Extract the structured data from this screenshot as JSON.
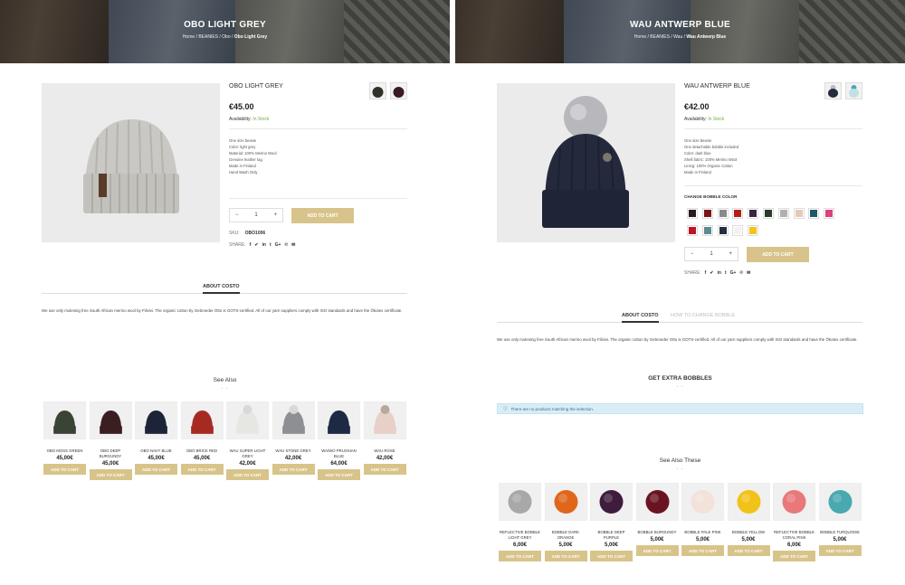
{
  "left": {
    "hero": {
      "title": "OBO LIGHT GREY",
      "crumb_path": "Home / BEANIES / Obo /",
      "crumb_current": "Obo Light Grey"
    },
    "product": {
      "title": "OBO LIGHT GREY",
      "price": "€45.00",
      "availability_label": "Availability:",
      "availability_value": "In Stock",
      "description": [
        "One size beanie",
        "Color: light grey",
        "Material: 100% Merino Wool",
        "Genuine leather tag",
        "Made in Finland",
        "Hand Wash Only"
      ],
      "qty": "1",
      "add_to_cart": "ADD TO CART",
      "sku_label": "SKU:",
      "sku_value": "OBO1006",
      "share_label": "SHARE:"
    },
    "tabs": [
      {
        "label": "ABOUT COSTO"
      }
    ],
    "about_text": "We use only mulesing free South African merino wool by Filivivi. The organic cotton by Gebroeder Otto is GOTS-certified. All of our yarn suppliers comply with ISO standards and have the Ökotex certificate.",
    "see_also": {
      "title": "See Also",
      "dots": "- -",
      "items": [
        {
          "name": "OBO MOSS GREEN",
          "price": "45,00€",
          "button": "ADD TO CART",
          "color": "#3a4436"
        },
        {
          "name": "OBO DEEP BURGUNDY",
          "price": "45,00€",
          "button": "ADD TO CART",
          "color": "#3b1e22"
        },
        {
          "name": "OBO NAVY BLUE",
          "price": "45,00€",
          "button": "ADD TO CART",
          "color": "#1e2438"
        },
        {
          "name": "OBO BRICK RED",
          "price": "45,00€",
          "button": "ADD TO CART",
          "color": "#a72a22"
        },
        {
          "name": "WAU SUPER LIGHT GREY",
          "price": "42,00€",
          "button": "ADD TO CART",
          "color": "#e6e6e2"
        },
        {
          "name": "WAU STONE GREY",
          "price": "42,00€",
          "button": "ADD TO CART",
          "color": "#8d8f92"
        },
        {
          "name": "WAIWO PRUSSIAN BLUE",
          "price": "64,00€",
          "button": "ADD TO CART",
          "color": "#1d2a44"
        },
        {
          "name": "WAU ROSE",
          "price": "42,00€",
          "button": "ADD TO CART",
          "color": "#e8cfc8"
        }
      ]
    }
  },
  "right": {
    "hero": {
      "title": "WAU ANTWERP BLUE",
      "crumb_path": "Home / BEANIES / Wau /",
      "crumb_current": "Wau Antwerp Blue"
    },
    "product": {
      "title": "WAU ANTWERP BLUE",
      "price": "€42.00",
      "availability_label": "Availability:",
      "availability_value": "In Stock",
      "description": [
        "One size beanie",
        "One detachable bobble included",
        "Color: dark blue",
        "Shell fabric: 100% Merino Wool",
        "Lining: 100% Organic Cotton",
        "Made in Finland"
      ],
      "change_bobble_label": "CHANGE BOBBLE COLOR",
      "swatches": [
        "#2a1a1c",
        "#7a1418",
        "#8a8a8a",
        "#b31f1a",
        "#3a2444",
        "#2c3a2a",
        "#b0b0b0",
        "#e8c8b8",
        "#1e5a66",
        "#e0407a",
        "#c01424",
        "#5a8c90",
        "#262c44",
        "#f2f2f2",
        "#f2c418"
      ],
      "qty": "1",
      "add_to_cart": "ADD TO CART",
      "share_label": "SHARE:"
    },
    "tabs": [
      {
        "label": "ABOUT COSTO"
      },
      {
        "label": "HOW TO CHANGE BOBBLE"
      }
    ],
    "about_text": "We use only mulesing free South African merino wool by Filivivi. The organic cotton by Gebroeder Otto is GOTS-certified. All of our yarn suppliers comply with ISO standards and have the Ökotex certificate.",
    "extra": {
      "title": "GET EXTRA BOBBLES",
      "dots": "- -",
      "notice": "There are no products matching the selection."
    },
    "see_also": {
      "title": "See Also These",
      "dots": "- -",
      "items": [
        {
          "name": "REFLECTIVE BOBBLE LIGHT GREY",
          "price": "6,00€",
          "button": "ADD TO CART",
          "color": "#a8a8a8"
        },
        {
          "name": "BOBBLE DARK ORANGE",
          "price": "5,00€",
          "button": "ADD TO CART",
          "color": "#e0661c"
        },
        {
          "name": "BOBBLE DEEP PURPLE",
          "price": "5,00€",
          "button": "ADD TO CART",
          "color": "#3e1c3c"
        },
        {
          "name": "BOBBLE BURGUNDY",
          "price": "5,00€",
          "button": "ADD TO CART",
          "color": "#6a1422"
        },
        {
          "name": "BOBBLE PALE PINK",
          "price": "5,00€",
          "button": "ADD TO CART",
          "color": "#f2e2da"
        },
        {
          "name": "BOBBLE YELLOW",
          "price": "5,00€",
          "button": "ADD TO CART",
          "color": "#f2c21a"
        },
        {
          "name": "REFLECTIVE BOBBLE CORAL PINK",
          "price": "6,00€",
          "button": "ADD TO CART",
          "color": "#e8787a"
        },
        {
          "name": "BOBBLE TURQUOISE",
          "price": "5,00€",
          "button": "ADD TO CART",
          "color": "#4aa8b0"
        }
      ]
    }
  }
}
